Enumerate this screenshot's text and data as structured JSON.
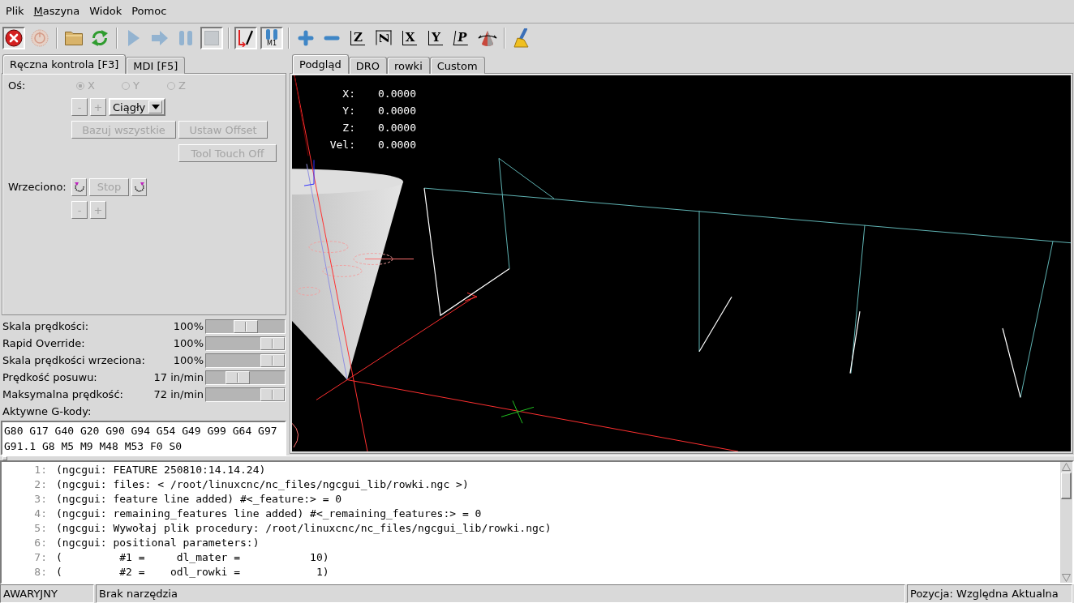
{
  "menu": [
    {
      "label": "Plik",
      "underline_first": false
    },
    {
      "label": "Maszyna",
      "underline_first": true
    },
    {
      "label": "Widok",
      "underline_first": false
    },
    {
      "label": "Pomoc",
      "underline_first": false
    }
  ],
  "toolbar_groups": [
    {
      "buttons": [
        {
          "kind": "estop",
          "pressed": true,
          "disabled": false
        },
        {
          "kind": "power",
          "pressed": false,
          "disabled": true
        }
      ]
    },
    {
      "buttons": [
        {
          "kind": "open",
          "pressed": false,
          "disabled": false
        },
        {
          "kind": "reload",
          "pressed": false,
          "disabled": false
        }
      ]
    },
    {
      "buttons": [
        {
          "kind": "run",
          "pressed": false,
          "disabled": true
        },
        {
          "kind": "step",
          "pressed": false,
          "disabled": true
        },
        {
          "kind": "pause",
          "pressed": false,
          "disabled": true
        },
        {
          "kind": "stop",
          "pressed": true,
          "disabled": true
        }
      ]
    },
    {
      "buttons": [
        {
          "kind": "block_delete",
          "pressed": true,
          "disabled": false
        },
        {
          "kind": "optional_stop",
          "label": "M1",
          "pressed": true,
          "disabled": false
        }
      ]
    },
    {
      "buttons": [
        {
          "kind": "zoom_in",
          "pressed": false,
          "disabled": false
        },
        {
          "kind": "zoom_out",
          "pressed": false,
          "disabled": false
        },
        {
          "kind": "view",
          "label": "Z",
          "pressed": false,
          "disabled": false
        },
        {
          "kind": "view_rotated",
          "label": "Z",
          "pressed": false,
          "disabled": false
        },
        {
          "kind": "view",
          "label": "X",
          "pressed": false,
          "disabled": false
        },
        {
          "kind": "view",
          "label": "Y",
          "pressed": false,
          "disabled": false
        },
        {
          "kind": "view_perspective",
          "label": "P",
          "pressed": false,
          "disabled": false
        },
        {
          "kind": "rotate",
          "pressed": false,
          "disabled": false
        }
      ]
    },
    {
      "buttons": [
        {
          "kind": "clear",
          "pressed": false,
          "disabled": false
        }
      ]
    }
  ],
  "left_tabs": [
    {
      "label": "Ręczna kontrola [F3]",
      "selected": true
    },
    {
      "label": "MDI [F5]",
      "selected": false
    }
  ],
  "manual_control": {
    "axis_label": "Oś:",
    "axes": [
      {
        "label": "X",
        "selected": true,
        "disabled": true
      },
      {
        "label": "Y",
        "selected": false,
        "disabled": true
      },
      {
        "label": "Z",
        "selected": false,
        "disabled": true
      }
    ],
    "jog_buttons": [
      {
        "label": "-",
        "disabled": true
      },
      {
        "label": "+",
        "disabled": true
      }
    ],
    "jog_mode": {
      "value": "Ciągły"
    },
    "home_button": {
      "label": "Bazuj wszystkie",
      "disabled": true
    },
    "offset_button": {
      "label": "Ustaw Offset",
      "disabled": true
    },
    "touch_off_button": {
      "label": "Tool Touch Off",
      "disabled": true
    },
    "spindle_label": "Wrzeciono:",
    "spindle_buttons": [
      {
        "kind": "ccw",
        "disabled": false
      },
      {
        "kind": "stop",
        "label": "Stop",
        "disabled": true
      },
      {
        "kind": "cw",
        "disabled": false
      }
    ],
    "spindle_speed_buttons": [
      {
        "label": "-",
        "disabled": true
      },
      {
        "label": "+",
        "disabled": true
      }
    ]
  },
  "overrides": [
    {
      "label": "Skala prędkości:",
      "reading": "100%",
      "level": 0.5
    },
    {
      "label": "Rapid Override:",
      "reading": "100%",
      "level": 1
    },
    {
      "label": "Skala prędkości wrzeciona:",
      "reading": "100%",
      "level": 1
    },
    {
      "label": "Prędkość posuwu:",
      "reading": "17 in/min",
      "level": 0.36
    },
    {
      "label": "Maksymalna prędkość:",
      "reading": "72 in/min",
      "level": 1
    }
  ],
  "active_gcodes": {
    "label": "Aktywne G-kody:",
    "lines": [
      "G80 G17 G40 G20 G90 G94 G54 G49 G99 G64 G97",
      "G91.1 G8 M5 M9 M48 M53 F0 S0"
    ]
  },
  "view_tabs": [
    {
      "label": "Podgląd",
      "selected": true
    },
    {
      "label": "DRO",
      "selected": false
    },
    {
      "label": "rowki",
      "selected": false
    },
    {
      "label": "Custom",
      "selected": false
    }
  ],
  "preview": {
    "dro": [
      {
        "label": "X:",
        "value": "0.0000"
      },
      {
        "label": "Y:",
        "value": "0.0000"
      },
      {
        "label": "Z:",
        "value": "0.0000"
      },
      {
        "label": "Vel:",
        "value": "0.0000"
      }
    ]
  },
  "gcode_listing": [
    {
      "number": "1:",
      "text": "(ngcgui: FEATURE 250810:14.14.24)"
    },
    {
      "number": "2:",
      "text": "(ngcgui: files: < /root/linuxcnc/nc_files/ngcgui_lib/rowki.ngc >)"
    },
    {
      "number": "3:",
      "text": "(ngcgui: feature line added) #<_feature:> = 0"
    },
    {
      "number": "4:",
      "text": "(ngcgui: remaining_features line added) #<_remaining_features:> = 0"
    },
    {
      "number": "5:",
      "text": "(ngcgui: Wywołaj plik procedury: /root/linuxcnc/nc_files/ngcgui_lib/rowki.ngc)"
    },
    {
      "number": "6:",
      "text": "(ngcgui: positional parameters:)"
    },
    {
      "number": "7:",
      "text": "(         #1 =     dl_mater =           10)"
    },
    {
      "number": "8:",
      "text": "(         #2 =    odl_rowki =            1)"
    }
  ],
  "status_bar": {
    "estop": "AWARYJNY",
    "tool": "Brak narzędzia",
    "position": "Pozycja: Względna Aktualna"
  }
}
